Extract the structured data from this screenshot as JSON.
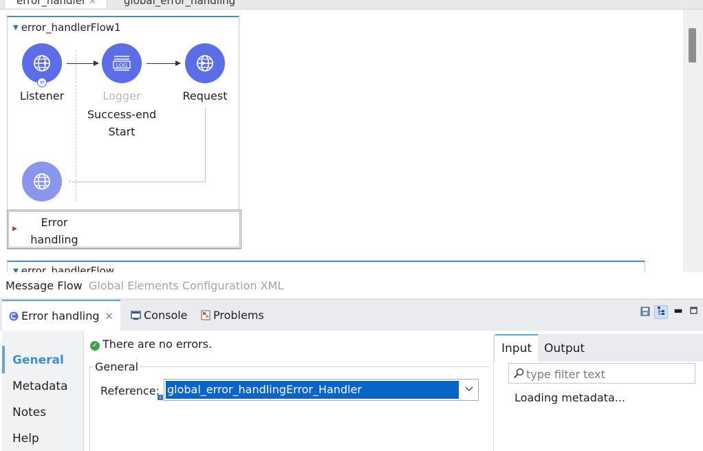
{
  "editor_tabs": {
    "active_label": "error_handler",
    "inactive_label": "global_error_handling"
  },
  "canvas": {
    "flow1": {
      "title": "error_handlerFlow1",
      "nodes": {
        "listener": "Listener",
        "logger": "Logger",
        "logger_sub_1": "Success-end",
        "logger_sub_2": "Start",
        "request": "Request",
        "logger_icon_text": "LOG"
      },
      "error_handling_line1": "Error",
      "error_handling_line2": "handling"
    },
    "flow2": {
      "title": "error_handlerFlow"
    }
  },
  "editor_views": {
    "message_flow": "Message Flow",
    "global_elements": "Global Elements",
    "configuration_xml": "Configuration XML"
  },
  "panel": {
    "tabs": {
      "error_handling": "Error handling",
      "console": "Console",
      "problems": "Problems"
    },
    "side_nav": [
      "General",
      "Metadata",
      "Notes",
      "Help"
    ],
    "status": "There are no errors.",
    "group_title": "General",
    "reference_label": "Reference:",
    "reference_value": "global_error_handlingError_Handler",
    "metadata": {
      "tab_input": "Input",
      "tab_output": "Output",
      "filter_placeholder": "type filter text",
      "loading": "Loading metadata..."
    }
  },
  "colors": {
    "node": "#5b6ee8",
    "accent": "#5fa8d3",
    "selection": "#0a64c8",
    "ok": "#3fa34d"
  }
}
